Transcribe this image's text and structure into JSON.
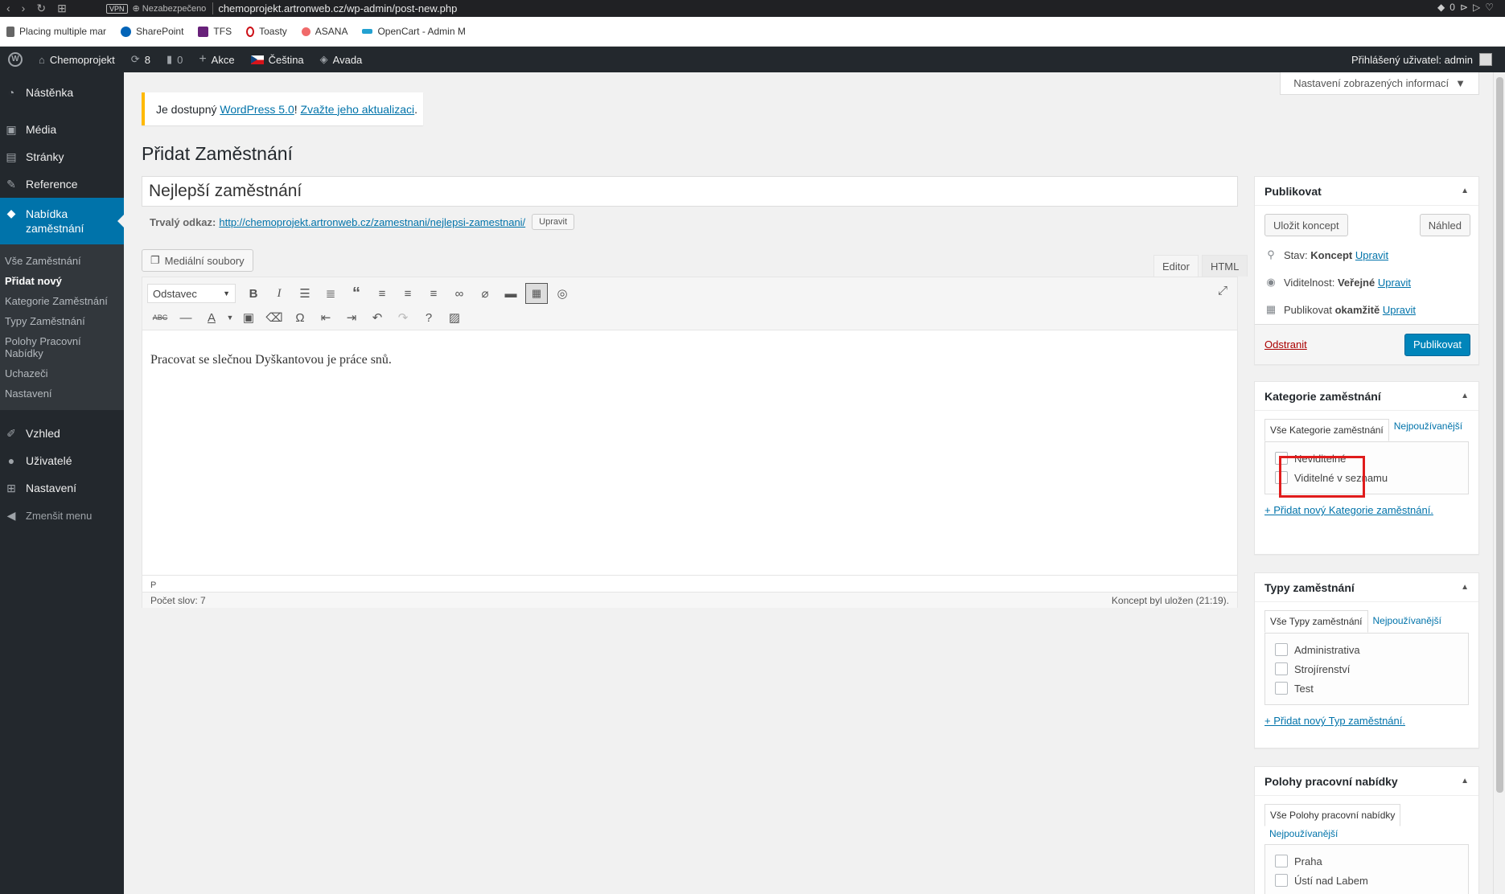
{
  "browser": {
    "vpn": "VPN",
    "security": "Nezabezpečeno",
    "url": "chemoprojekt.artronweb.cz/wp-admin/post-new.php",
    "badge": "0",
    "bookmarks": [
      {
        "label": "Placing multiple mar",
        "icon": "page-icon",
        "color": "#666"
      },
      {
        "label": "SharePoint",
        "icon": "sharepoint-icon",
        "color": "#0364b8"
      },
      {
        "label": "TFS",
        "icon": "tfs-icon",
        "color": "#68217a"
      },
      {
        "label": "Toasty",
        "icon": "opera-icon",
        "color": "#cc0f16"
      },
      {
        "label": "ASANA",
        "icon": "asana-icon",
        "color": "#f06a6a"
      },
      {
        "label": "OpenCart - Admin M",
        "icon": "opencart-icon",
        "color": "#23a1d1"
      }
    ]
  },
  "adminbar": {
    "site": "Chemoprojekt",
    "updates": "8",
    "comments": "0",
    "new": "Akce",
    "language": "Čeština",
    "theme": "Avada",
    "user": "Přihlášený uživatel: admin"
  },
  "sidebar": {
    "dashboard": "Nástěnka",
    "media": "Média",
    "pages": "Stránky",
    "reference": "Reference",
    "jobs_line1": "Nabídka",
    "jobs_line2": "zaměstnání",
    "sub": {
      "all": "Vše Zaměstnání",
      "add": "Přidat nový",
      "categories": "Kategorie Zaměstnání",
      "types": "Typy Zaměstnání",
      "positions_line1": "Polohy Pracovní",
      "positions_line2": "Nabídky",
      "applicants": "Uchazeči",
      "settings": "Nastavení"
    },
    "appearance": "Vzhled",
    "users": "Uživatelé",
    "settings": "Nastavení",
    "collapse": "Zmenšit menu"
  },
  "notice": {
    "pre": "Je dostupný ",
    "link1": "WordPress 5.0",
    "mid": "! ",
    "link2": "Zvažte jeho aktualizaci",
    "post": "."
  },
  "screen_options": "Nastavení zobrazených informací",
  "page_title": "Přidat Zaměstnání",
  "post_title": "Nejlepší zaměstnání",
  "permalink": {
    "label": "Trvalý odkaz:",
    "url": "http://chemoprojekt.artronweb.cz/zamestnani/nejlepsi-zamestnani/",
    "edit": "Upravit"
  },
  "media_button": "Mediální soubory",
  "editor_tabs": {
    "visual": "Editor",
    "html": "HTML"
  },
  "format_select": "Odstavec",
  "editor_content": "Pracovat se slečnou Dyškantovou je práce snů.",
  "path": "P",
  "word_count": "Počet slov: 7",
  "autosave": "Koncept byl uložen (21:19).",
  "publish": {
    "title": "Publikovat",
    "save_draft": "Uložit koncept",
    "preview": "Náhled",
    "status_label": "Stav: ",
    "status_value": "Koncept",
    "visibility_label": "Viditelnost: ",
    "visibility_value": "Veřejné",
    "schedule_label": "Publikovat ",
    "schedule_value": "okamžitě",
    "edit": "Upravit",
    "delete": "Odstranit",
    "publish_btn": "Publikovat"
  },
  "categories": {
    "title": "Kategorie zaměstnání",
    "tab_all": "Vše Kategorie zaměstnání",
    "tab_popular": "Nejpoužívanější",
    "items": [
      "Neviditelné",
      "Viditelné v seznamu"
    ],
    "add_new": "+ Přidat nový Kategorie zaměstnání."
  },
  "types": {
    "title": "Typy zaměstnání",
    "tab_all": "Vše Typy zaměstnání",
    "tab_popular": "Nejpoužívanější",
    "items": [
      "Administrativa",
      "Strojírenství",
      "Test"
    ],
    "add_new": "+ Přidat nový Typ zaměstnání."
  },
  "positions": {
    "title": "Polohy pracovní nabídky",
    "tab_all": "Vše Polohy pracovní nabídky",
    "tab_popular": "Nejpoužívanější",
    "items": [
      "Praha",
      "Ústí nad Labem"
    ]
  }
}
